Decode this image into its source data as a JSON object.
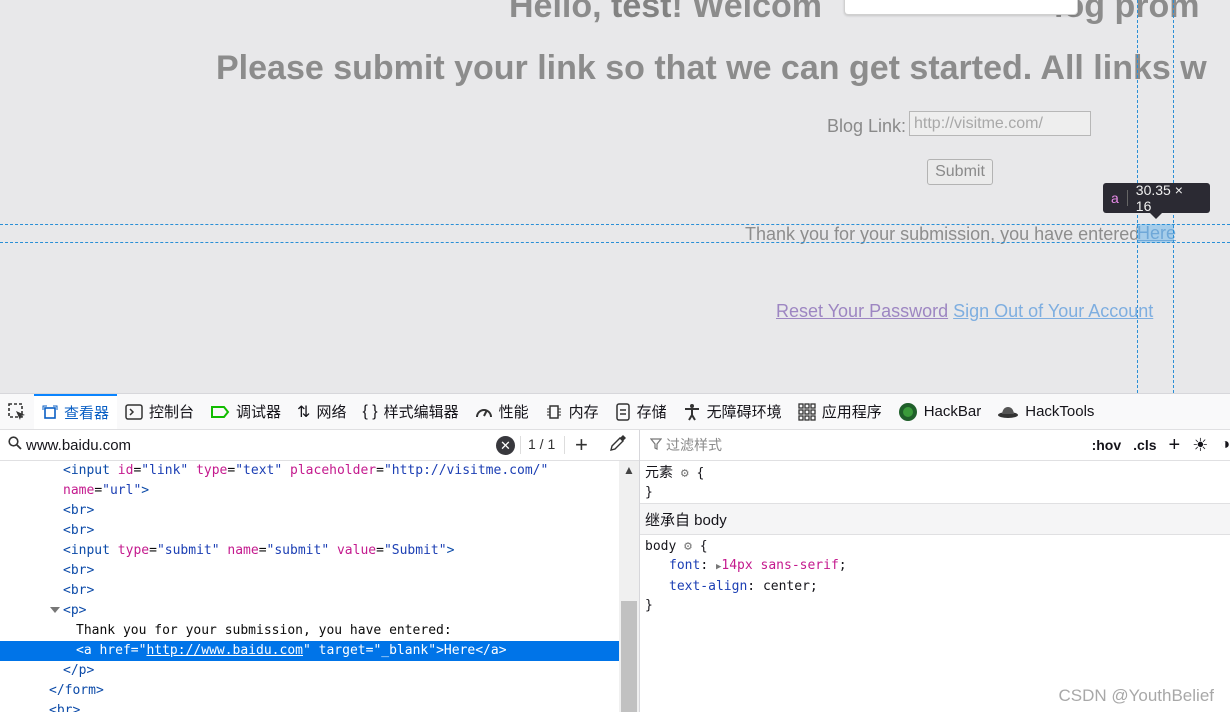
{
  "page": {
    "heading_prefix": "Hello, ",
    "heading_user": "test",
    "heading_rest": "! Welcom",
    "heading_tail": "log prom",
    "heading2": "Please submit your link so that we can get started. All links w",
    "blog_label": "Blog Link:",
    "blog_placeholder": "http://visitme.com/",
    "submit_label": "Submit",
    "thank_you": "Thank you for your submission, you have entered:",
    "here_link": "Here",
    "reset_link": "Reset Your Password",
    "signout_link": "Sign Out of Your Account"
  },
  "tooltip": {
    "tag": "a",
    "size": "30.35 × 16"
  },
  "devtools": {
    "tabs": [
      {
        "label": "查看器",
        "icon": "inspector-icon",
        "active": true
      },
      {
        "label": "控制台",
        "icon": "console-icon"
      },
      {
        "label": "调试器",
        "icon": "debugger-icon"
      },
      {
        "label": "网络",
        "icon": "network-icon"
      },
      {
        "label": "样式编辑器",
        "icon": "style-editor-icon"
      },
      {
        "label": "性能",
        "icon": "performance-icon"
      },
      {
        "label": "内存",
        "icon": "memory-icon"
      },
      {
        "label": "存储",
        "icon": "storage-icon"
      },
      {
        "label": "无障碍环境",
        "icon": "accessibility-icon"
      },
      {
        "label": "应用程序",
        "icon": "application-icon"
      },
      {
        "label": "HackBar",
        "icon": "hackbar-icon"
      },
      {
        "label": "HackTools",
        "icon": "hacktools-icon"
      }
    ],
    "search_value": "www.baidu.com",
    "search_count": "1 / 1",
    "markup": {
      "l1_id": "link",
      "l1_type": "text",
      "l1_placeholder": "http://visitme.com/",
      "l2_name": "url",
      "l6_type": "submit",
      "l6_name": "submit",
      "l6_value": "Submit",
      "text_node": "Thank you for your submission, you have entered:",
      "a_href": "http://www.baidu.com",
      "a_target": "_blank",
      "a_text": "Here"
    },
    "rules": {
      "filter_placeholder": "过滤样式",
      "hov": ":hov",
      "cls": ".cls",
      "element_label": "元素",
      "inherited_label": "继承自 body",
      "selector": "body",
      "font_prop": "font",
      "font_val": "14px sans-serif",
      "align_prop": "text-align",
      "align_val": "center"
    }
  },
  "watermark": "CSDN @YouthBelief"
}
